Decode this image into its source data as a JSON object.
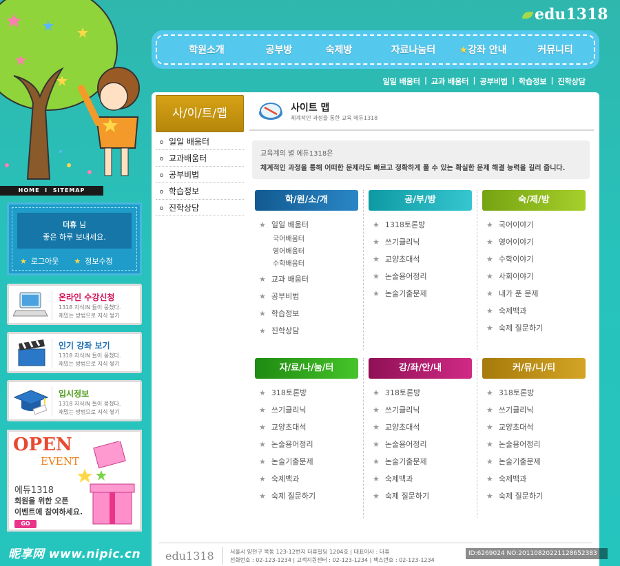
{
  "brand": {
    "logo_text": "edu1318",
    "watermark": "昵享网 www.nipic.cn"
  },
  "homebar": {
    "home": "HOME",
    "sep": "I",
    "sitemap": "SITEMAP"
  },
  "nav": [
    {
      "label": "학원소개"
    },
    {
      "label": "공부방"
    },
    {
      "label": "숙제방"
    },
    {
      "label": "자료나눔터"
    },
    {
      "label": "강좌 안내",
      "star": "★"
    },
    {
      "label": "커뮤니티"
    }
  ],
  "subnav": [
    "일일 배움터",
    "교과 배움터",
    "공부비법",
    "학습정보",
    "진학상담"
  ],
  "subnav_sep": "|",
  "login": {
    "user": "더휴",
    "suffix": "님",
    "greeting": "좋은 하루 보내세요.",
    "logout": "로그아웃",
    "edit": "정보수정"
  },
  "cards": [
    {
      "title": "온라인 수강신청",
      "title_color": "#d4145a",
      "line1": "1318 지식IN 들이 뭉쳤다.",
      "line2": "재밌는 방법으로 지식 쌓기",
      "icon": "laptop-icon"
    },
    {
      "title": "인기 강좌 보기",
      "title_color": "#1b6fb5",
      "line1": "1318 지식IN 들이 뭉쳤다.",
      "line2": "재밌는 방법으로 지식 쌓기",
      "icon": "clapperboard-icon"
    },
    {
      "title": "입시정보",
      "title_color": "#4a9a16",
      "line1": "1318 지식IN 들이 뭉쳤다.",
      "line2": "재밌는 방법으로 지식 쌓기",
      "icon": "graduation-cap-icon"
    }
  ],
  "event": {
    "open": "OPEN",
    "ev": "EVENT",
    "line1": "에듀1318",
    "line2": "회원을 위한 오픈",
    "line3": "이벤트에 참여하세요.",
    "go": "GO"
  },
  "sidebar": {
    "title": "사/이/트/맵",
    "items": [
      "일일 배움터",
      "교과배움터",
      "공부비법",
      "학습정보",
      "진학상담"
    ]
  },
  "page": {
    "title": "사이트 맵",
    "subtitle": "체계적인 과정을 통한 교육 에듀1318",
    "intro1": "교육계의 별 에듀1318은",
    "intro2": "체계적인 과정을 통해 어떠한 문제라도 빠르고 정확하게 풀 수 있는 확실한 문제 해결 능력을 길러 줍니다."
  },
  "columns": [
    {
      "title": "학/원/소/개",
      "color": "#1a6da8",
      "items": [
        {
          "t": "일일 배움터"
        },
        {
          "t": "국어배움터",
          "sub": true
        },
        {
          "t": "영어배움터",
          "sub": true
        },
        {
          "t": "수학배움터",
          "sub": true
        },
        {
          "t": "교과 배움터"
        },
        {
          "t": "공부비법"
        },
        {
          "t": "학습정보"
        },
        {
          "t": "진학상담"
        }
      ]
    },
    {
      "title": "공/부/방",
      "color": "#17aeb6",
      "items": [
        {
          "t": "1318토론방"
        },
        {
          "t": "쓰기클리닉"
        },
        {
          "t": "교양초대석"
        },
        {
          "t": "논술용어정리"
        },
        {
          "t": "논술기출문제"
        }
      ]
    },
    {
      "title": "숙/제/방",
      "color": "#88b51b",
      "items": [
        {
          "t": "국어이야기"
        },
        {
          "t": "영어이야기"
        },
        {
          "t": "수학이야기"
        },
        {
          "t": "사회이야기"
        },
        {
          "t": "내가 푼 문제"
        },
        {
          "t": "숙제백과"
        },
        {
          "t": "숙제 질문하기"
        }
      ]
    },
    {
      "title": "자/료/나/눔/터",
      "color": "#2c9a1a",
      "items": [
        {
          "t": "318토론방"
        },
        {
          "t": "쓰기클리닉"
        },
        {
          "t": "교양초대석"
        },
        {
          "t": "논술용어정리"
        },
        {
          "t": "논술기출문제"
        },
        {
          "t": "숙제백과"
        },
        {
          "t": "숙제 질문하기"
        }
      ]
    },
    {
      "title": "강/좌/안/내",
      "color": "#b01a6b",
      "items": [
        {
          "t": "318토론방"
        },
        {
          "t": "쓰기클리닉"
        },
        {
          "t": "교양초대석"
        },
        {
          "t": "논술용어정리"
        },
        {
          "t": "논술기출문제"
        },
        {
          "t": "숙제백과"
        },
        {
          "t": "숙제 질문하기"
        }
      ]
    },
    {
      "title": "커/뮤/니/티",
      "color": "#c09518",
      "items": [
        {
          "t": "318토론방"
        },
        {
          "t": "쓰기클리닉"
        },
        {
          "t": "교양초대석"
        },
        {
          "t": "논술용어정리"
        },
        {
          "t": "논술기출문제"
        },
        {
          "t": "숙제백과"
        },
        {
          "t": "숙제 질문하기"
        }
      ]
    }
  ],
  "footer": {
    "logo": "edu1318",
    "line1": "서울시 양천구 목동 123-12번지 더휴빌딩 1204호   |   대표이사 : 더휴",
    "line2": "전화번호 : 02-123-1234   |   고객지원센터 : 02-123-1234   |   팩스번호 : 02-123-1234"
  },
  "stamp": "ID:6269024 NO:20110820221128652383"
}
